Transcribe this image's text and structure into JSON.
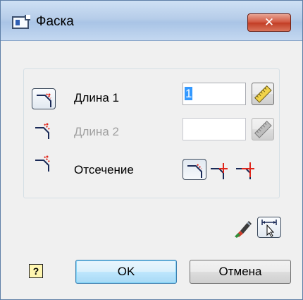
{
  "window": {
    "title": "Фаска",
    "close_glyph": "✕"
  },
  "rows": [
    {
      "label": "Длина 1",
      "value": "1",
      "enabled": true
    },
    {
      "label": "Длина 2",
      "value": "",
      "enabled": false
    },
    {
      "label": "Отсечение"
    }
  ],
  "buttons": {
    "ok": "OK",
    "cancel": "Отмена",
    "help_glyph": "?"
  },
  "icons": {
    "app": "window-icon",
    "chamfer": "chamfer-icon",
    "ruler": "ruler-icon",
    "trim_modes": [
      "trim-both-icon",
      "trim-first-icon",
      "trim-none-icon"
    ],
    "brush": "brush-icon",
    "select_dims": "select-dimensions-icon"
  },
  "colors": {
    "accent_red": "#e0261b",
    "ok_border": "#3c7fb1"
  }
}
